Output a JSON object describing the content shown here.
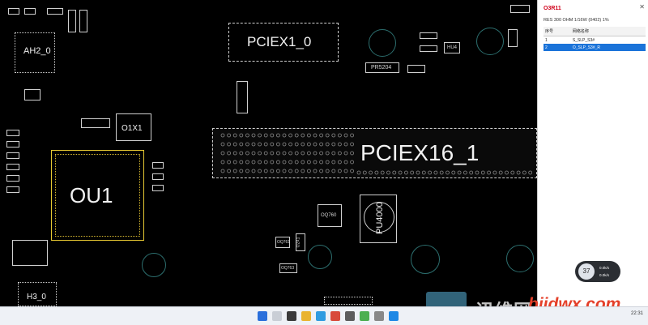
{
  "canvas": {
    "labels": {
      "ah2": "AH2_0",
      "pciex1": "PCIEX1_0",
      "pciex16": "PCIEX16_1",
      "ou1": "OU1",
      "o1x1": "O1X1",
      "pu4000": "PU4000",
      "h3": "H3_0",
      "pr5204": "PR5204",
      "hu4": "HU4",
      "oq760": "OQ760",
      "oq761": "OQ761",
      "o2x1": "O2X1",
      "oq763": "OQ763"
    }
  },
  "panel": {
    "net_title": "O3R11",
    "close": "✕",
    "description": "RES 300 OHM 1/16W (0402) 1%",
    "columns": [
      "序号",
      "网络名称"
    ],
    "rows": [
      {
        "idx": "1",
        "name": "S_SLP_S3#"
      },
      {
        "idx": "2",
        "name": "O_SLP_S3#_R"
      }
    ]
  },
  "widget": {
    "value": "37",
    "r1": "0.0k/s",
    "r2": "0.0k/s"
  },
  "watermark": {
    "text": "迅维网",
    "url": "bjjdwx.com"
  },
  "taskbar": {
    "time": "22:31"
  },
  "colors": {
    "accent": "#1a73d9",
    "net_title": "#d0021b",
    "watermark_url": "#e4402a"
  }
}
